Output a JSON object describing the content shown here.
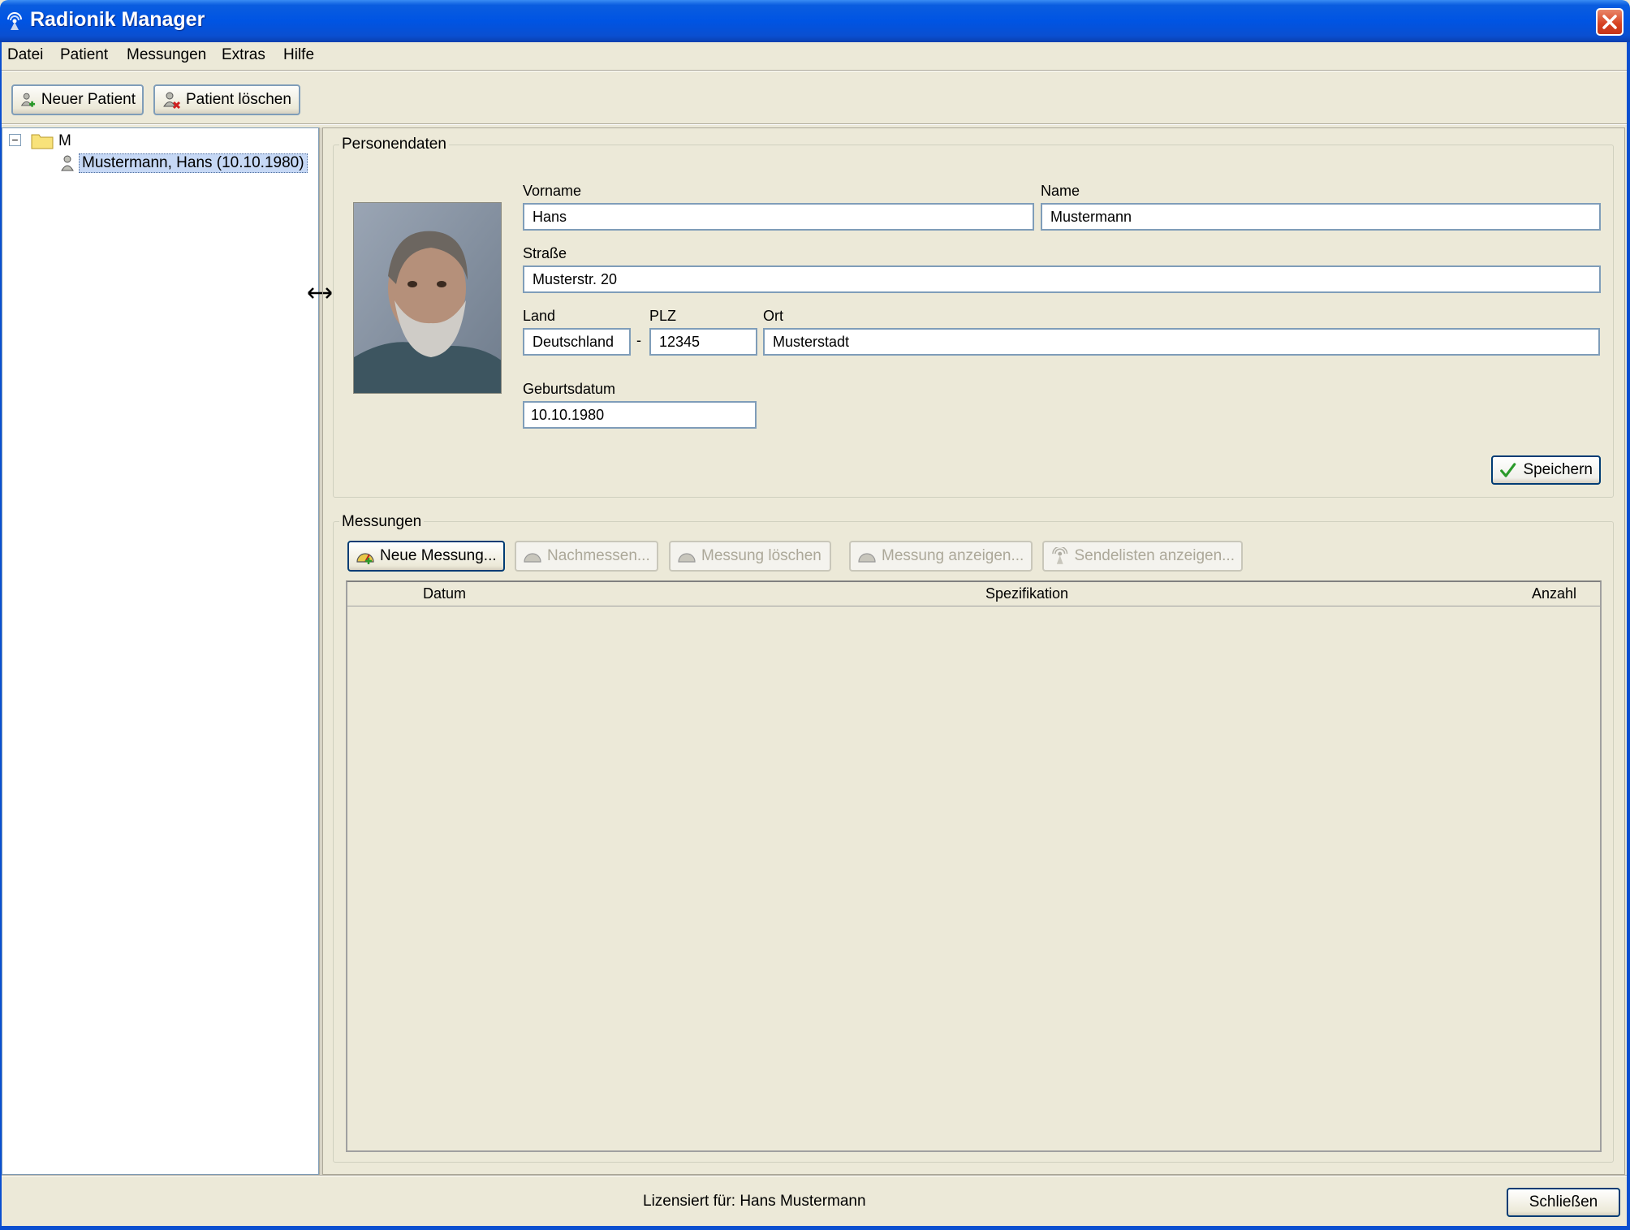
{
  "window": {
    "title": "Radionik Manager"
  },
  "menu": [
    "Datei",
    "Patient",
    "Messungen",
    "Extras",
    "Hilfe"
  ],
  "toolbar": {
    "new_patient": "Neuer Patient",
    "delete_patient": "Patient löschen"
  },
  "tree": {
    "root_label": "M",
    "patient_label": "Mustermann, Hans  (10.10.1980)"
  },
  "personendaten": {
    "legend": "Personendaten",
    "vorname_label": "Vorname",
    "vorname": "Hans",
    "name_label": "Name",
    "name": "Mustermann",
    "strasse_label": "Straße",
    "strasse": "Musterstr. 20",
    "land_label": "Land",
    "land": "Deutschland",
    "dash": "-",
    "plz_label": "PLZ",
    "plz": "12345",
    "ort_label": "Ort",
    "ort": "Musterstadt",
    "geburtsdatum_label": "Geburtsdatum",
    "geburtsdatum": "10.10.1980",
    "save": "Speichern"
  },
  "messungen": {
    "legend": "Messungen",
    "buttons": [
      "Neue Messung...",
      "Nachmessen...",
      "Messung löschen",
      "Messung anzeigen...",
      "Sendelisten anzeigen..."
    ],
    "columns": [
      "Datum",
      "Spezifikation",
      "Anzahl"
    ]
  },
  "status": {
    "license": "Lizensiert für: Hans Mustermann",
    "close": "Schließen"
  },
  "colors": {
    "titlebar": "#0054e3",
    "background": "#ece9d8",
    "selection": "#c6d8f5",
    "input_border": "#7f9db9"
  }
}
